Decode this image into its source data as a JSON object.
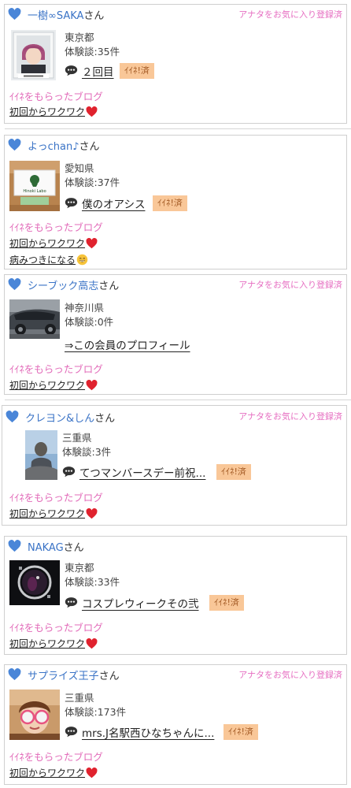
{
  "cards": [
    {
      "user_name": "一樹∞SAKA",
      "san": "さん",
      "favorite_note": "アナタをお気に入り登録済",
      "prefecture": "東京都",
      "review_count": "体験談:35件",
      "post_title": "２回目",
      "iine_badge": "ｲｲﾈ!済",
      "blog_header": "ｲｲﾈをもらったブログ",
      "blogs": [
        "初回からワクワク"
      ]
    },
    {
      "user_name": "よっchan♪",
      "san": "さん",
      "prefecture": "愛知県",
      "review_count": "体験談:37件",
      "post_title": "僕のオアシス",
      "iine_badge": "ｲｲﾈ!済",
      "avatar_text": "Hinoki Labo",
      "blog_header": "ｲｲﾈをもらったブログ",
      "blogs": [
        "初回からワクワク",
        "病みつきになる"
      ]
    },
    {
      "user_name": "シーブック高志",
      "san": "さん",
      "favorite_note": "アナタをお気に入り登録済",
      "prefecture": "神奈川県",
      "review_count": "体験談:0件",
      "profile_link": "⇒この会員のプロフィール",
      "blog_header": "ｲｲﾈをもらったブログ",
      "blogs": [
        "初回からワクワク"
      ]
    },
    {
      "user_name": "クレヨン&しん",
      "san": "さん",
      "favorite_note": "アナタをお気に入り登録済",
      "prefecture": "三重県",
      "review_count": "体験談:3件",
      "post_title": "てつマンバースデー前祝...",
      "iine_badge": "ｲｲﾈ!済",
      "blog_header": "ｲｲﾈをもらったブログ",
      "blogs": [
        "初回からワクワク"
      ]
    },
    {
      "user_name": "NAKAG",
      "san": "さん",
      "prefecture": "東京都",
      "review_count": "体験談:33件",
      "post_title": "コスプレウィークその弐",
      "iine_badge": "ｲｲﾈ!済",
      "blog_header": "ｲｲﾈをもらったブログ",
      "blogs": [
        "初回からワクワク"
      ]
    },
    {
      "user_name": "サプライズ王子",
      "san": "さん",
      "favorite_note": "アナタをお気に入り登録済",
      "prefecture": "三重県",
      "review_count": "体験談:173件",
      "post_title": "mrs.J名駅西ひなちゃんに...",
      "iine_badge": "ｲｲﾈ!済",
      "blog_header": "ｲｲﾈをもらったブログ",
      "blogs": [
        "初回からワクワク"
      ]
    }
  ],
  "colors": {
    "user_name": "#3a73c6",
    "favorite_note": "#e66ec1",
    "blog_header": "#e26bb9",
    "badge_bg": "#f9c798",
    "heart": "#4a86d8"
  },
  "icons": {
    "heart": "heart-icon",
    "comment": "speech-bubble-icon",
    "red_heart": "red-heart-emoji",
    "grin": "grinning-face-emoji"
  }
}
